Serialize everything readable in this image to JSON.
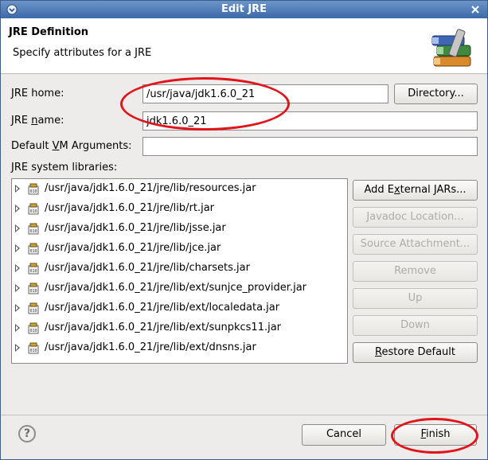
{
  "window": {
    "title": "Edit JRE",
    "title_bar_color": "#4a76b2"
  },
  "header": {
    "title": "JRE Definition",
    "subtitle": "Specify attributes for a JRE",
    "icon": "books-icon"
  },
  "form": {
    "jre_home_label": "JRE home:",
    "jre_home_value": "/usr/java/jdk1.6.0_21",
    "directory_button": "Directory...",
    "jre_name_label_pre": "JRE ",
    "jre_name_label_mn": "n",
    "jre_name_label_post": "ame:",
    "jre_name_value": "jdk1.6.0_21",
    "vm_args_label_pre": "Default ",
    "vm_args_label_mn": "V",
    "vm_args_label_post": "M Arguments:",
    "vm_args_value": ""
  },
  "libraries": {
    "label": "JRE system libraries:",
    "items": [
      "/usr/java/jdk1.6.0_21/jre/lib/resources.jar",
      "/usr/java/jdk1.6.0_21/jre/lib/rt.jar",
      "/usr/java/jdk1.6.0_21/jre/lib/jsse.jar",
      "/usr/java/jdk1.6.0_21/jre/lib/jce.jar",
      "/usr/java/jdk1.6.0_21/jre/lib/charsets.jar",
      "/usr/java/jdk1.6.0_21/jre/lib/ext/sunjce_provider.jar",
      "/usr/java/jdk1.6.0_21/jre/lib/ext/localedata.jar",
      "/usr/java/jdk1.6.0_21/jre/lib/ext/sunpkcs11.jar",
      "/usr/java/jdk1.6.0_21/jre/lib/ext/dnsns.jar"
    ]
  },
  "side_buttons": {
    "add_external_pre": "Add E",
    "add_external_mn": "x",
    "add_external_post": "ternal JARs...",
    "javadoc": "Javadoc Location...",
    "source": "Source Attachment...",
    "remove": "Remove",
    "up": "Up",
    "down": "Down",
    "restore_mn": "R",
    "restore_post": "estore Default"
  },
  "footer": {
    "help": "?",
    "cancel": "Cancel",
    "finish_mn": "F",
    "finish_post": "inish"
  },
  "annotation_color": "#e0141a"
}
